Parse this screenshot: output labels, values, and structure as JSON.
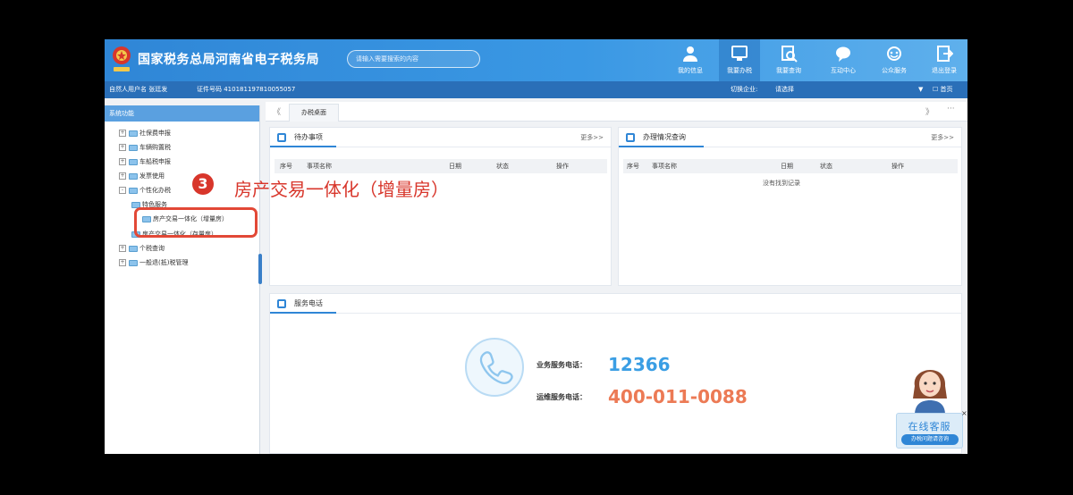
{
  "header": {
    "site_title": "国家税务总局河南省电子税务局",
    "search_placeholder": "请输入需要搜索的内容",
    "nav": [
      {
        "label": "我的信息",
        "icon": "user-icon"
      },
      {
        "label": "我要办税",
        "icon": "monitor-icon"
      },
      {
        "label": "我要查询",
        "icon": "search-doc-icon"
      },
      {
        "label": "互动中心",
        "icon": "chat-icon"
      },
      {
        "label": "公众服务",
        "icon": "service-icon"
      },
      {
        "label": "退出登录",
        "icon": "logout-icon"
      }
    ]
  },
  "userbar": {
    "user_label": "自然人用户名 张廷发",
    "id_label": "证件号码 410181197810055057",
    "switch_label": "切换企业:",
    "switch_value": "请选择",
    "home_label": "首页"
  },
  "sidebar": {
    "title": "系统功能",
    "items": [
      {
        "label": "社保费申报",
        "sign": "+"
      },
      {
        "label": "车辆购置税",
        "sign": "+"
      },
      {
        "label": "车船税申报",
        "sign": "+"
      },
      {
        "label": "发票使用",
        "sign": "+"
      },
      {
        "label": "个性化办税",
        "sign": "-"
      },
      {
        "label": "特色服务",
        "sign": ""
      },
      {
        "label": "房产交易一体化（增量房）",
        "sign": ""
      },
      {
        "label": "房产交易一体化（存量房）",
        "sign": ""
      },
      {
        "label": "个税查询",
        "sign": "+"
      },
      {
        "label": "一般退(抵)税管理",
        "sign": "+"
      }
    ]
  },
  "tabs": {
    "active": "办税桌面",
    "prev": "《",
    "next": "》",
    "more": "···"
  },
  "todo_panel": {
    "title": "待办事项",
    "more": "更多>>",
    "columns": [
      "序号",
      "事项名称",
      "日期",
      "状态",
      "操作"
    ]
  },
  "status_panel": {
    "title": "办理情况查询",
    "more": "更多>>",
    "columns": [
      "序号",
      "事项名称",
      "日期",
      "状态",
      "操作"
    ],
    "empty_text": "没有找到记录"
  },
  "service_panel": {
    "title": "服务电话",
    "business_label": "业务服务电话：",
    "business_number": "12366",
    "ops_label": "运维服务电话：",
    "ops_number": "400-011-0088"
  },
  "callout": {
    "number": "3",
    "text": "房产交易一体化（增量房）"
  },
  "online_service": {
    "title": "在线客服",
    "subtitle": "办税问题请咨询",
    "close": "×"
  },
  "colors": {
    "header_blue": "#2f86d6",
    "callout_red": "#d8362b",
    "phone_blue": "#3a9ee4",
    "phone_orange": "#ec7a55"
  }
}
